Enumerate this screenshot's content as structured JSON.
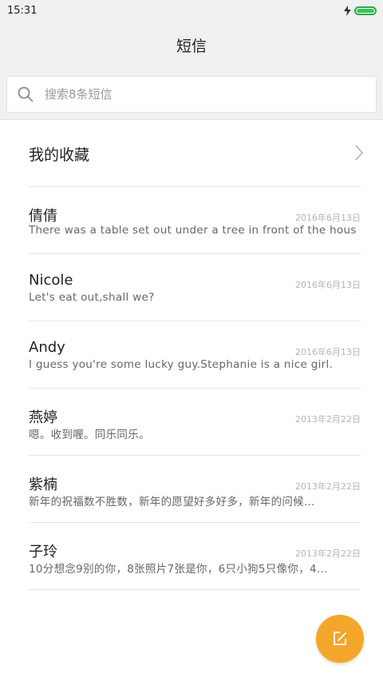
{
  "status": {
    "time": "15:31",
    "battery_level": 1.0
  },
  "header": {
    "title": "短信"
  },
  "search": {
    "placeholder": "搜索8条短信"
  },
  "favorites": {
    "label": "我的收藏"
  },
  "conversations": [
    {
      "name": "倩倩",
      "date": "2016年6月13日",
      "preview": "There was a table set out under a tree in front of the hous"
    },
    {
      "name": "Nicole",
      "date": "2016年6月13日",
      "preview": "Let's eat out,shall we?"
    },
    {
      "name": "Andy",
      "date": "2016年6月13日",
      "preview": "I guess you're some lucky guy.Stephanie is a nice girl."
    },
    {
      "name": "燕婷",
      "date": "2013年2月22日",
      "preview": "嗯。收到喔。同乐同乐。"
    },
    {
      "name": "紫楠",
      "date": "2013年2月22日",
      "preview": "新年的祝福数不胜数，新年的愿望好多好多，新年的问候…"
    },
    {
      "name": "子玲",
      "date": "2013年2月22日",
      "preview": "10分想念9别的你，8张照片7张是你，6只小狗5只像你，4…"
    }
  ],
  "icons": {
    "search": "search-icon",
    "chevron": "chevron-right-icon",
    "compose": "compose-icon",
    "charging": "charging-icon",
    "battery": "battery-icon"
  },
  "colors": {
    "accent": "#f4a62a",
    "battery": "#3cc35a",
    "header_bg": "#f0f0f0"
  }
}
